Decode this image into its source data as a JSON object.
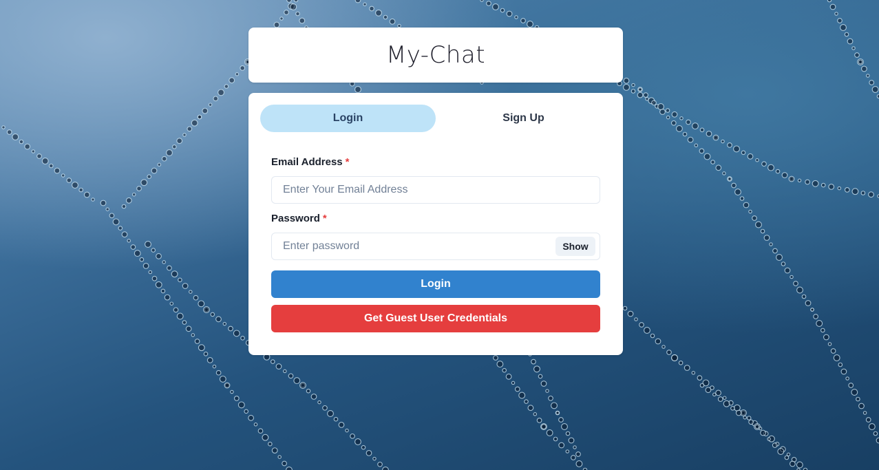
{
  "app": {
    "title": "My-Chat"
  },
  "tabs": [
    {
      "label": "Login",
      "active": true
    },
    {
      "label": "Sign Up",
      "active": false
    }
  ],
  "form": {
    "email": {
      "label": "Email Address",
      "required_mark": "*",
      "placeholder": "Enter Your Email Address",
      "value": ""
    },
    "password": {
      "label": "Password",
      "required_mark": "*",
      "placeholder": "Enter password",
      "value": "",
      "toggle_label": "Show"
    },
    "login_button": "Login",
    "guest_button": "Get Guest User Credentials"
  },
  "colors": {
    "active_tab_bg": "#bee3f8",
    "primary_button": "#3182ce",
    "danger_button": "#e53e3e",
    "required_star": "#e53e3e"
  }
}
